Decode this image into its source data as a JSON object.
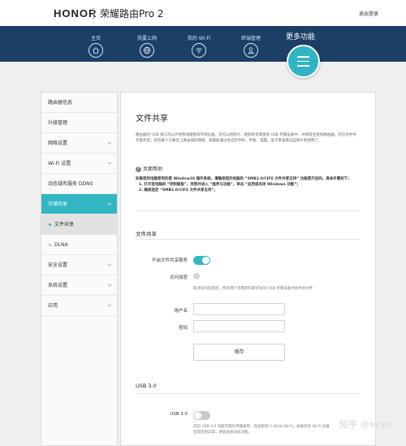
{
  "header": {
    "brand": "HONOR",
    "model": "荣耀路由Pro 2",
    "logout": "退出登录"
  },
  "nav": {
    "items": [
      {
        "label": "主页",
        "icon": "home-icon"
      },
      {
        "label": "我要上网",
        "icon": "globe-icon"
      },
      {
        "label": "我的 Wi-Fi",
        "icon": "wifi-icon"
      },
      {
        "label": "终端管理",
        "icon": "user-icon"
      }
    ],
    "more_label": "更多功能",
    "more_icon": "menu-icon"
  },
  "sidebar": {
    "items": [
      {
        "label": "路由器信息"
      },
      {
        "label": "升级管理"
      },
      {
        "label": "网络设置"
      },
      {
        "label": "Wi-Fi 设置"
      },
      {
        "label": "动态域名服务 DDNS"
      },
      {
        "label": "存储共享"
      },
      {
        "label": "文件共享"
      },
      {
        "label": "DLNA"
      },
      {
        "label": "安全设置"
      },
      {
        "label": "系统设置"
      },
      {
        "label": "应用"
      }
    ]
  },
  "main": {
    "title": "文件共享",
    "description": "路由器的 USB 接口可以外接移动硬盘等存储设备。您可以将照片、视频等资源放到 USB 存储设备中，并将其连接到路由器。开启文件共享服务后，您的家人只要连上路由器的网络，就都能通过各自的手机、平板、电脑、盒子来查看这些照片和视频了。",
    "help": {
      "title": "页面帮助",
      "intro": "如果您的电脑使用的是 Window10 操作系统，请确保您的电脑的 “SMB1.0/CIFS 文件共享支持” 功能是开启的。具体步骤如下：",
      "step1": "1. 打开您电脑的 “控制面板”，找到并进入 “程序与功能”，单击 “启用或关闭 Windows 功能”；",
      "step2": "2. 确保选定 “SMB1.0/CIFS 文件共享支持”。"
    },
    "file_share": {
      "section_title": "文件共享",
      "enable_label": "开启文件共享服务",
      "enable_on": true,
      "access_label": "访问加密",
      "access_hint": "取消访问加密后，所有用户无需密码即可访问 USB 存储设备中的共享文件",
      "username_label": "用户名",
      "username_value": "",
      "password_label": "密码",
      "password_value": "",
      "save_label": "保存"
    },
    "usb3": {
      "section_title": "USB 3.0",
      "label": "USB 3.0",
      "on": false,
      "hint": "开启 USB 3.0 功能可提升传输速率，但会影响 2.4GHz Wi-Fi。如果您的 Wi-Fi 设备出现连接异常，请您试关闭此功能。"
    }
  },
  "watermark": "知乎 @syys",
  "colors": {
    "nav_bg": "#1c3f66",
    "accent": "#33b6c3"
  }
}
